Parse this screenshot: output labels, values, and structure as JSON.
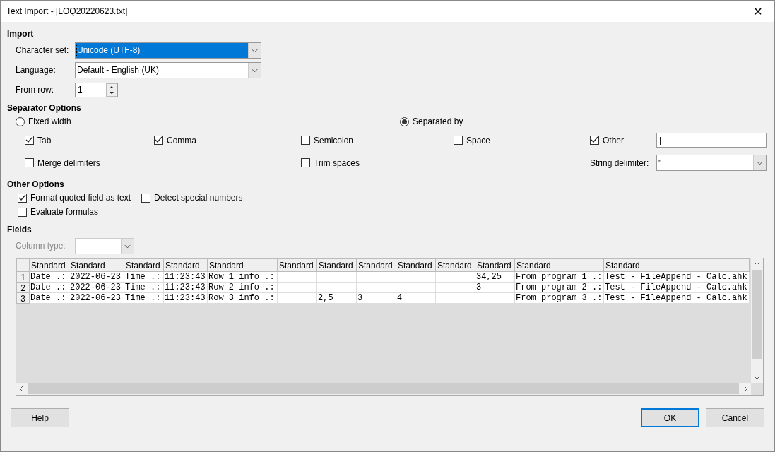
{
  "window": {
    "title": "Text Import - [LOQ20220623.txt]",
    "close": "✕"
  },
  "import": {
    "heading": "Import",
    "fields": [
      {
        "kind": "select",
        "label": "Character set:",
        "value": "Unicode (UTF-8)",
        "focused": true
      },
      {
        "kind": "select",
        "label": "Language:",
        "value": "Default - English (UK)",
        "focused": false
      },
      {
        "kind": "spin",
        "label": "From row:",
        "value": "1",
        "focused": false
      }
    ]
  },
  "separator": {
    "heading": "Separator Options",
    "modes": [
      {
        "label": "Fixed width",
        "selected": false
      },
      {
        "label": "Separated by",
        "selected": true
      }
    ],
    "options": [
      {
        "label": "Tab",
        "checked": true
      },
      {
        "label": "Comma",
        "checked": true
      },
      {
        "label": "Semicolon",
        "checked": false
      },
      {
        "label": "Space",
        "checked": false
      },
      {
        "label": "Other",
        "checked": true
      }
    ],
    "other_value": "|",
    "options2": [
      {
        "label": "Merge delimiters",
        "checked": false
      },
      {
        "label": "Trim spaces",
        "checked": false
      }
    ],
    "string_delimiter": {
      "label": "String delimiter:",
      "value": "\""
    }
  },
  "other": {
    "heading": "Other Options",
    "options": [
      {
        "label": "Format quoted field as text",
        "checked": true
      },
      {
        "label": "Detect special numbers",
        "checked": false
      },
      {
        "label": "Evaluate formulas",
        "checked": false
      }
    ]
  },
  "fields": {
    "heading": "Fields",
    "column_type": {
      "label": "Column type:",
      "disabled": true
    },
    "columns": [
      "Standard",
      "Standard",
      "Standard",
      "Standard",
      "Standard",
      "Standard",
      "Standard",
      "Standard",
      "Standard",
      "Standard",
      "Standard",
      "Standard",
      "Standard"
    ],
    "rows": [
      {
        "number": "1",
        "cells": [
          "Date .:",
          "2022-06-23",
          "Time .:",
          "11:23:43",
          "Row 1 info .:",
          "",
          "",
          "",
          "",
          "",
          "34,25",
          "From program 1 .:",
          "Test - FileAppend - Calc.ahk"
        ]
      },
      {
        "number": "2",
        "cells": [
          "Date .:",
          "2022-06-23",
          "Time .:",
          "11:23:43",
          "Row 2 info .:",
          "",
          "",
          "",
          "",
          "",
          "3",
          "From program 2 .:",
          "Test - FileAppend - Calc.ahk"
        ]
      },
      {
        "number": "3",
        "cells": [
          "Date .:",
          "2022-06-23",
          "Time .:",
          "11:23:43",
          "Row 3 info .:",
          "",
          "2,5",
          "3",
          "4",
          "",
          "",
          "From program 3 .:",
          "Test - FileAppend - Calc.ahk"
        ]
      }
    ]
  },
  "buttons": [
    {
      "label": "Help",
      "default": false
    },
    {
      "label": "OK",
      "default": true
    },
    {
      "label": "Cancel",
      "default": false
    }
  ]
}
